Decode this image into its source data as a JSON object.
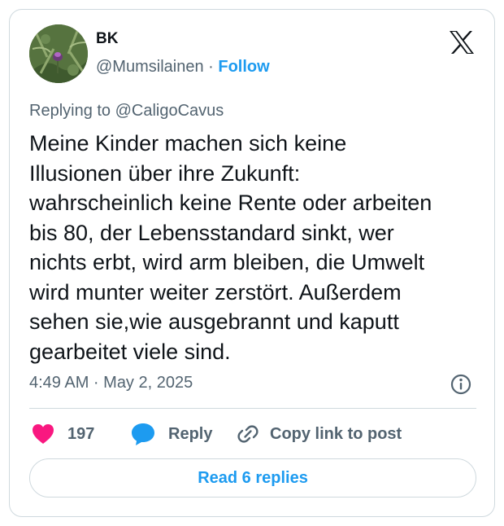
{
  "author": {
    "name": "BK",
    "handle": "@Mumsilainen",
    "separator": "·",
    "follow_label": "Follow",
    "avatar_icon": "thistle-photo-avatar"
  },
  "brand_icon": "x-logo-icon",
  "replying_to": "Replying to @CaligoCavus",
  "tweet": {
    "lines": [
      "Meine Kinder machen sich keine",
      "Illusionen über ihre Zukunft:",
      "wahrscheinlich keine Rente oder arbeiten",
      "bis 80, der Lebensstandard sinkt, wer",
      "nichts erbt, wird arm bleiben, die Umwelt",
      "wird munter weiter zerstört. Außerdem",
      "sehen sie,wie ausgebrannt und kaputt",
      "gearbeitet viele sind."
    ]
  },
  "timestamp": "4:49 AM · May 2, 2025",
  "actions": {
    "like_count": "197",
    "reply_label": "Reply",
    "copy_label": "Copy link to post"
  },
  "read_replies_label": "Read 6 replies",
  "colors": {
    "accent": "#1d9bf0",
    "like": "#f91880",
    "text": "#0f1419",
    "muted": "#536471",
    "border": "#cfd9de"
  }
}
